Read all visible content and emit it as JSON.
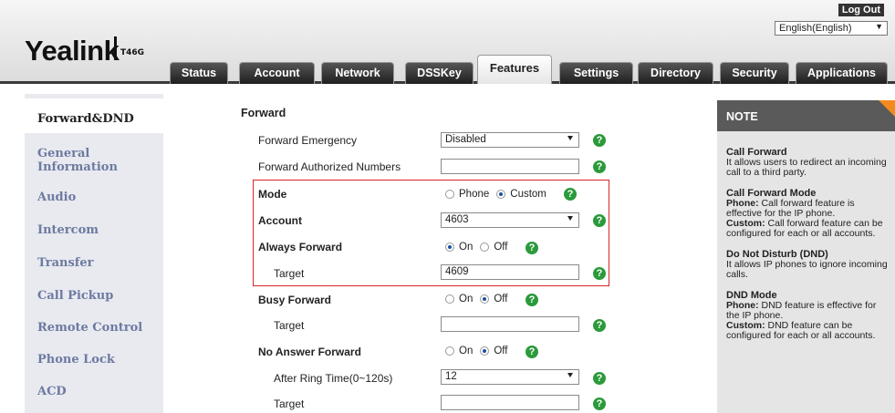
{
  "header": {
    "brand": "Yealink",
    "model": "T46G",
    "logout": "Log Out",
    "language": "English(English)",
    "tabs": [
      "Status",
      "Account",
      "Network",
      "DSSKey",
      "Features",
      "Settings",
      "Directory",
      "Security",
      "Applications"
    ],
    "active_tab": "Features"
  },
  "sidebar": {
    "items": [
      "Forward&DND",
      "General Information",
      "Audio",
      "Intercom",
      "Transfer",
      "Call Pickup",
      "Remote Control",
      "Phone Lock",
      "ACD"
    ],
    "active": "Forward&DND"
  },
  "forward": {
    "section_title": "Forward",
    "forward_emergency": {
      "label": "Forward Emergency",
      "value": "Disabled"
    },
    "forward_authorized": {
      "label": "Forward Authorized Numbers",
      "value": ""
    },
    "mode": {
      "label": "Mode",
      "options": [
        "Phone",
        "Custom"
      ],
      "selected": "Custom"
    },
    "account": {
      "label": "Account",
      "value": "4603"
    },
    "always_forward": {
      "label": "Always Forward",
      "options": [
        "On",
        "Off"
      ],
      "selected": "On",
      "target_label": "Target",
      "target": "4609"
    },
    "busy_forward": {
      "label": "Busy Forward",
      "options": [
        "On",
        "Off"
      ],
      "selected": "Off",
      "target_label": "Target",
      "target": ""
    },
    "no_answer_forward": {
      "label": "No Answer Forward",
      "options": [
        "On",
        "Off"
      ],
      "selected": "Off",
      "ring_time_label": "After Ring Time(0~120s)",
      "ring_time": "12",
      "target_label": "Target",
      "target": ""
    }
  },
  "help_glyph": "?",
  "note": {
    "title": "NOTE",
    "call_forward_title": "Call Forward",
    "call_forward_text": "It allows users to redirect an incoming call to a third party.",
    "cf_mode_title": "Call Forward Mode",
    "cf_phone_key": "Phone:",
    "cf_phone_text": "Call forward feature is effective for the IP phone.",
    "cf_custom_key": "Custom:",
    "cf_custom_text": "Call forward feature can be configured for each or all accounts.",
    "dnd_title": "Do Not Disturb (DND)",
    "dnd_text": "It allows IP phones to ignore incoming calls.",
    "dnd_mode_title": "DND Mode",
    "dnd_phone_key": "Phone:",
    "dnd_phone_text": "DND feature is effective for the IP phone.",
    "dnd_custom_key": "Custom:",
    "dnd_custom_text": "DND feature can be configured for each or all accounts."
  },
  "colors": {
    "accent_orange": "#f28a1f",
    "help_green": "#2b9a3b",
    "highlight_red": "#d7262a",
    "nav_blue": "#6d7aa0"
  }
}
